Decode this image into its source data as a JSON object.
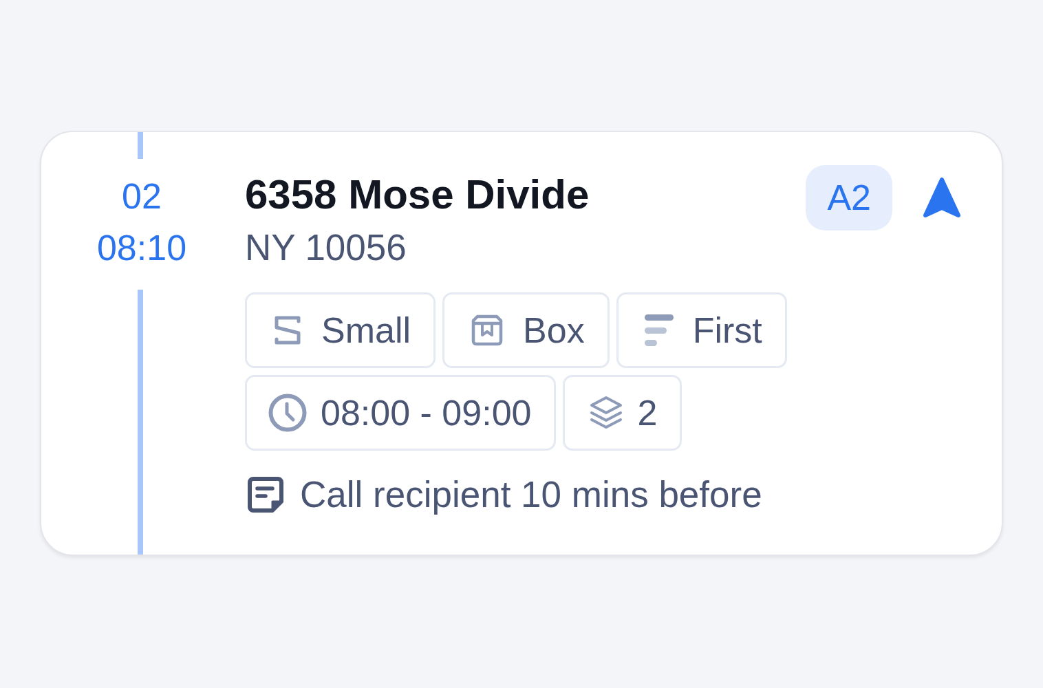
{
  "stop": {
    "sequence": "02",
    "eta": "08:10",
    "address": "6358 Mose Divide",
    "region": "NY 10056",
    "zone_badge": "A2",
    "tags": [
      {
        "kind": "size",
        "label": "Small"
      },
      {
        "kind": "package",
        "label": "Box"
      },
      {
        "kind": "priority",
        "label": "First"
      },
      {
        "kind": "time_window",
        "label": "08:00 - 09:00"
      },
      {
        "kind": "items",
        "label": "2"
      }
    ],
    "note": "Call recipient 10 mins before"
  }
}
